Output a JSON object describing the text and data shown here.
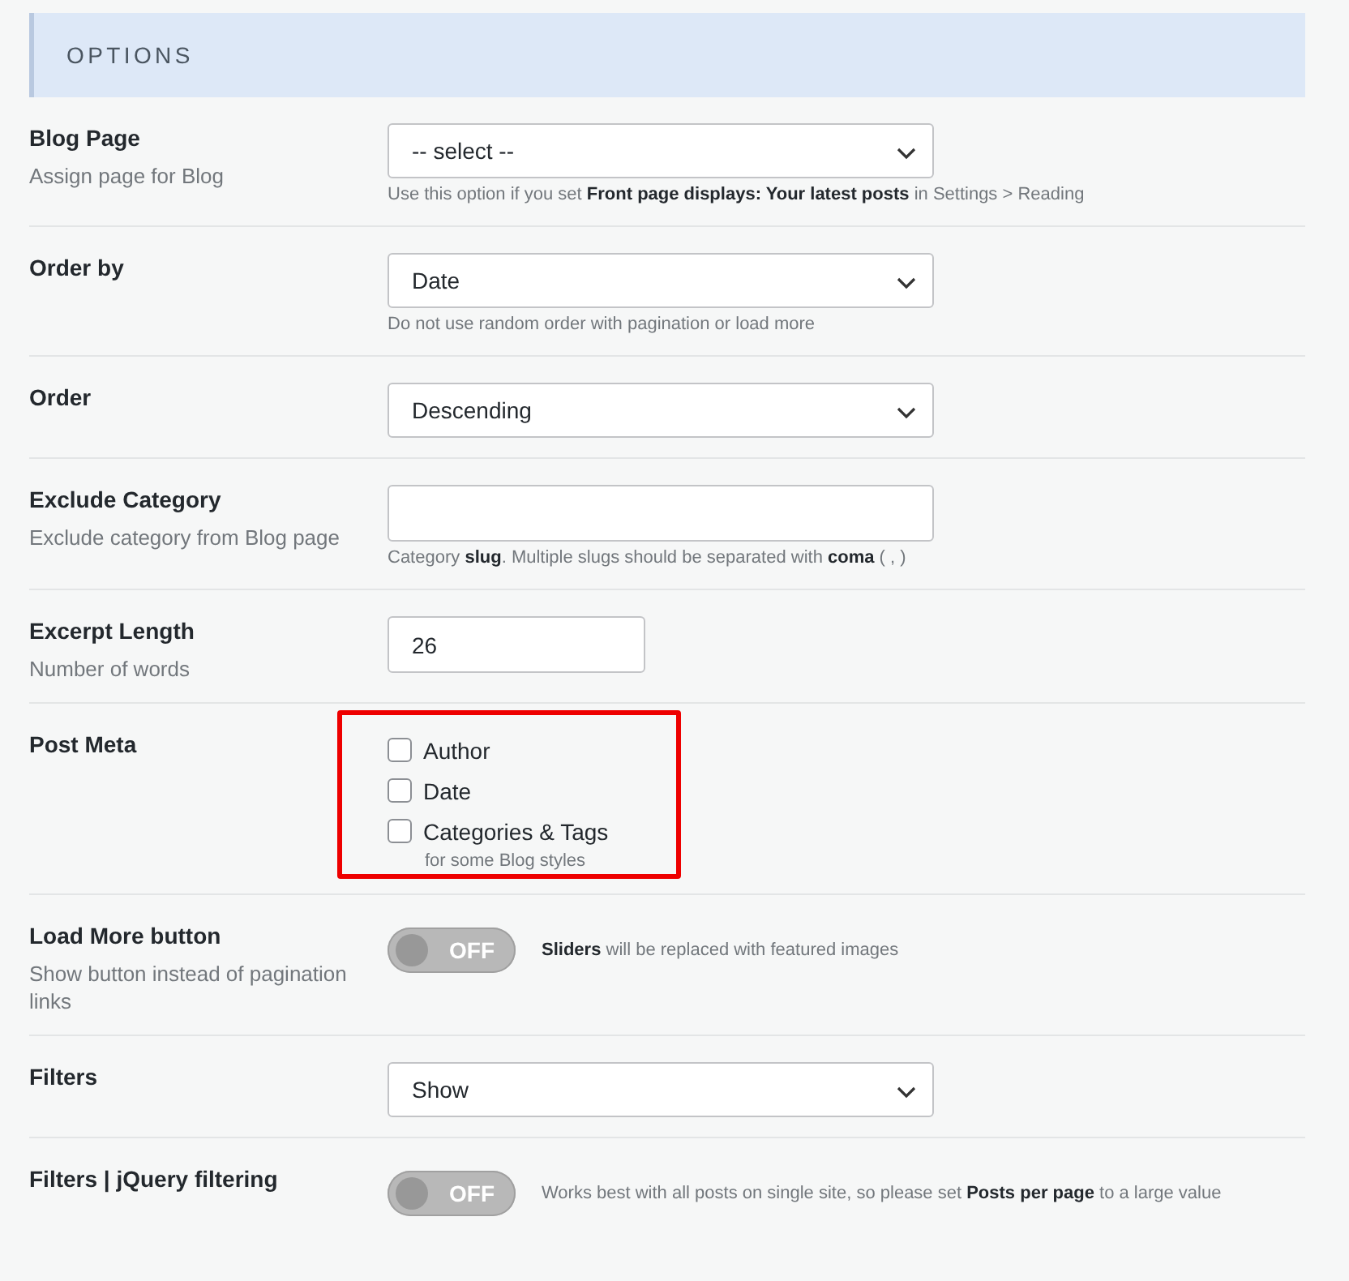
{
  "section_title": "OPTIONS",
  "rows": [
    {
      "kind": "select",
      "label": "Blog Page",
      "description": "Assign page for Blog",
      "value": "-- select --",
      "help": "Use this option if you set **Front page displays: Your latest posts** in Settings > Reading"
    },
    {
      "kind": "select",
      "label": "Order by",
      "value": "Date",
      "help": "Do not use random order with pagination or load more"
    },
    {
      "kind": "select",
      "label": "Order",
      "value": "Descending"
    },
    {
      "kind": "text",
      "label": "Exclude Category",
      "description": "Exclude category from Blog page",
      "help": "Category **slug**. Multiple slugs should be separated with **coma** ( , )"
    },
    {
      "kind": "number",
      "label": "Excerpt Length",
      "description": "Number of words",
      "value": "26"
    },
    {
      "kind": "checkboxes",
      "label": "Post Meta",
      "highlighted": true,
      "options": [
        {
          "label": "Author",
          "checked": false
        },
        {
          "label": "Date",
          "checked": false
        },
        {
          "label": "Categories & Tags",
          "checked": false
        }
      ],
      "note": "for some Blog styles"
    },
    {
      "kind": "toggle",
      "label": "Load More button",
      "description": "Show button instead of pagination links",
      "on": false,
      "state_text": "OFF",
      "help": "**Sliders** will be replaced with featured images"
    },
    {
      "kind": "select",
      "label": "Filters",
      "value": "Show"
    },
    {
      "kind": "toggle",
      "label": "Filters | jQuery filtering",
      "on": false,
      "state_text": "OFF",
      "help": "Works best with all posts on single site, so please set **Posts per page** to a large value"
    }
  ]
}
